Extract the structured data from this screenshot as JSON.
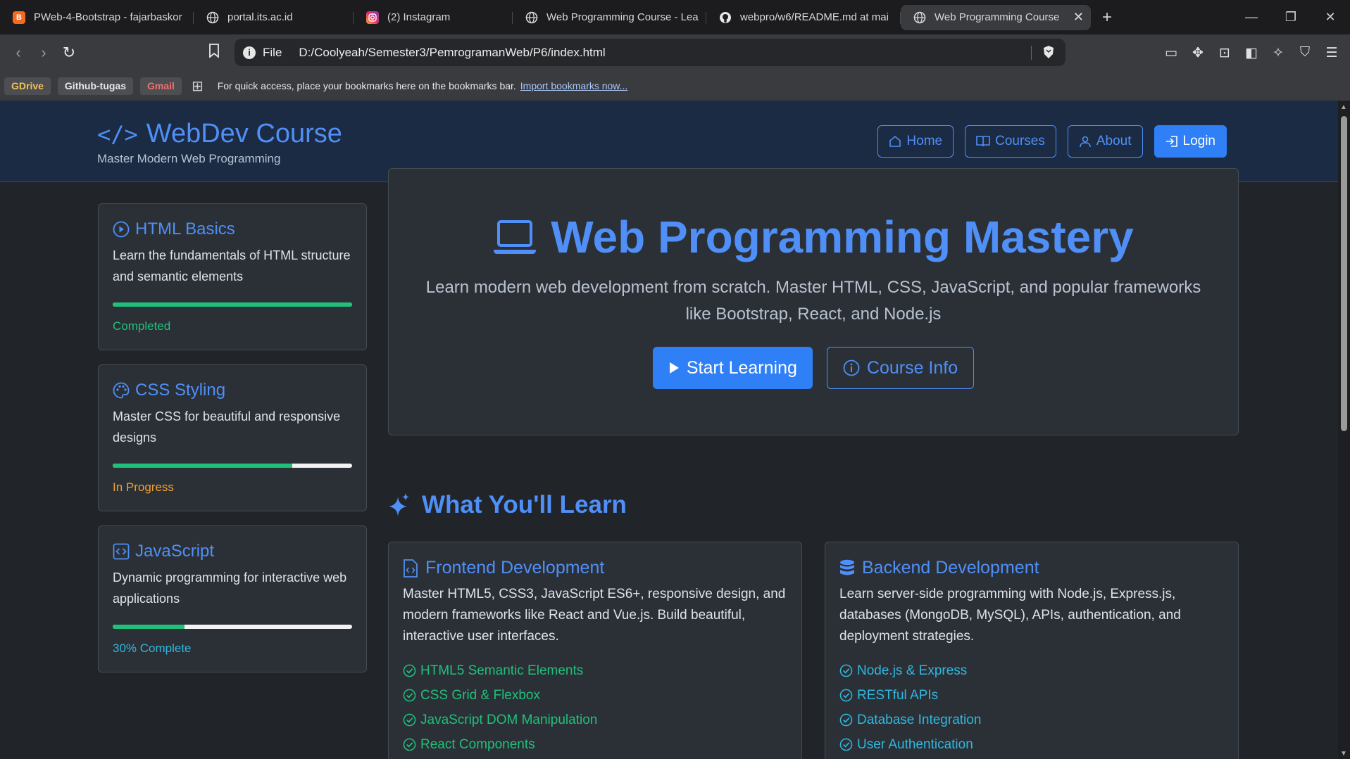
{
  "browser": {
    "tabs": [
      {
        "title": "PWeb-4-Bootstrap - fajarbaskor",
        "icon": "blogger-icon",
        "color": "#f36b21"
      },
      {
        "title": "portal.its.ac.id",
        "icon": "globe-icon"
      },
      {
        "title": "(2) Instagram",
        "icon": "instagram-icon"
      },
      {
        "title": "Web Programming Course - Lea",
        "icon": "globe-icon"
      },
      {
        "title": "webpro/w6/README.md at mai",
        "icon": "github-icon"
      },
      {
        "title": "Web Programming Course",
        "icon": "globe-icon",
        "active": true
      }
    ],
    "address": {
      "scheme_label": "File",
      "url": "D:/Coolyeah/Semester3/PemrogramanWeb/P6/index.html"
    },
    "bookmarks": [
      "GDrive",
      "Github-tugas",
      "Gmail"
    ],
    "bookmarks_hint": "For quick access, place your bookmarks here on the bookmarks bar.",
    "bookmarks_import": "Import bookmarks now..."
  },
  "header": {
    "brand": "WebDev Course",
    "tagline": "Master Modern Web Programming",
    "nav": [
      "Home",
      "Courses",
      "About",
      "Login"
    ]
  },
  "sidebar": [
    {
      "title": "HTML Basics",
      "desc": "Learn the fundamentals of HTML structure and semantic elements",
      "progress": 100,
      "status": "Completed",
      "status_color": "#20c07a"
    },
    {
      "title": "CSS Styling",
      "desc": "Master CSS for beautiful and responsive designs",
      "progress": 75,
      "status": "In Progress",
      "status_color": "#f0a030"
    },
    {
      "title": "JavaScript",
      "desc": "Dynamic programming for interactive web applications",
      "progress": 30,
      "status": "30% Complete",
      "status_color": "#2fb8e0"
    }
  ],
  "hero": {
    "title": "Web Programming Mastery",
    "subtitle": "Learn modern web development from scratch. Master HTML, CSS, JavaScript, and popular frameworks like Bootstrap, React, and Node.js",
    "primary_btn": "Start Learning",
    "secondary_btn": "Course Info"
  },
  "learn": {
    "title": "What You'll Learn",
    "cards": [
      {
        "title": "Frontend Development",
        "desc": "Master HTML5, CSS3, JavaScript ES6+, responsive design, and modern frameworks like React and Vue.js. Build beautiful, interactive user interfaces.",
        "items": [
          "HTML5 Semantic Elements",
          "CSS Grid & Flexbox",
          "JavaScript DOM Manipulation",
          "React Components"
        ]
      },
      {
        "title": "Backend Development",
        "desc": "Learn server-side programming with Node.js, Express.js, databases (MongoDB, MySQL), APIs, authentication, and deployment strategies.",
        "items": [
          "Node.js & Express",
          "RESTful APIs",
          "Database Integration",
          "User Authentication"
        ]
      }
    ]
  },
  "colors": {
    "accent": "#4f8ff7",
    "primary_btn": "#2f80f6",
    "success": "#20c07a",
    "warning": "#f0a030",
    "info": "#2fb8e0",
    "header_bg": "#1b2b44",
    "card_bg": "#2b3036",
    "page_bg": "#212529"
  }
}
